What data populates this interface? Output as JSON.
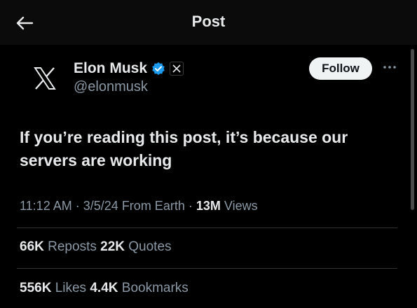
{
  "header": {
    "title": "Post",
    "back_icon": "arrow-left-icon"
  },
  "author": {
    "name": "Elon Musk",
    "handle": "@elonmusk",
    "avatar_icon": "x-logo-icon",
    "verified_icon": "verified-badge-icon",
    "affiliate_icon": "x-affiliate-badge-icon"
  },
  "actions": {
    "follow_label": "Follow",
    "more_icon": "more-icon"
  },
  "post": {
    "text": "If you’re reading this post, it’s because our servers are working"
  },
  "meta": {
    "time": "11:12 AM",
    "sep1": "·",
    "date": "3/5/24",
    "source": "From Earth",
    "sep2": "·",
    "views_count": "13M",
    "views_label": "Views"
  },
  "stats": {
    "reposts_count": "66K",
    "reposts_label": "Reposts",
    "quotes_count": "22K",
    "quotes_label": "Quotes",
    "likes_count": "556K",
    "likes_label": "Likes",
    "bookmarks_count": "4.4K",
    "bookmarks_label": "Bookmarks"
  },
  "colors": {
    "background": "#000000",
    "text_primary": "#e7e9ea",
    "text_secondary": "#8b98a5",
    "verified_blue": "#1d9bf0",
    "divider": "#2f3336"
  }
}
